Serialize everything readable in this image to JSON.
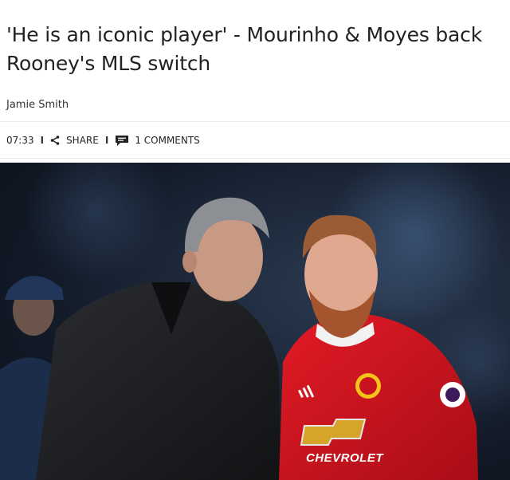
{
  "article": {
    "headline": "'He is an iconic player' - Mourinho & Moyes back Rooney's MLS switch",
    "author": "Jamie Smith",
    "time": "07:33",
    "share_label": "SHARE",
    "comments_label": "1 COMMENTS"
  },
  "photo": {
    "jersey_sponsor": "CHEVROLET",
    "kit_colors": {
      "red": "#d3111c",
      "coat": "#1d1f22",
      "background": "#131b29"
    }
  },
  "icons": {
    "share": "share-icon",
    "comment": "comment-icon"
  }
}
